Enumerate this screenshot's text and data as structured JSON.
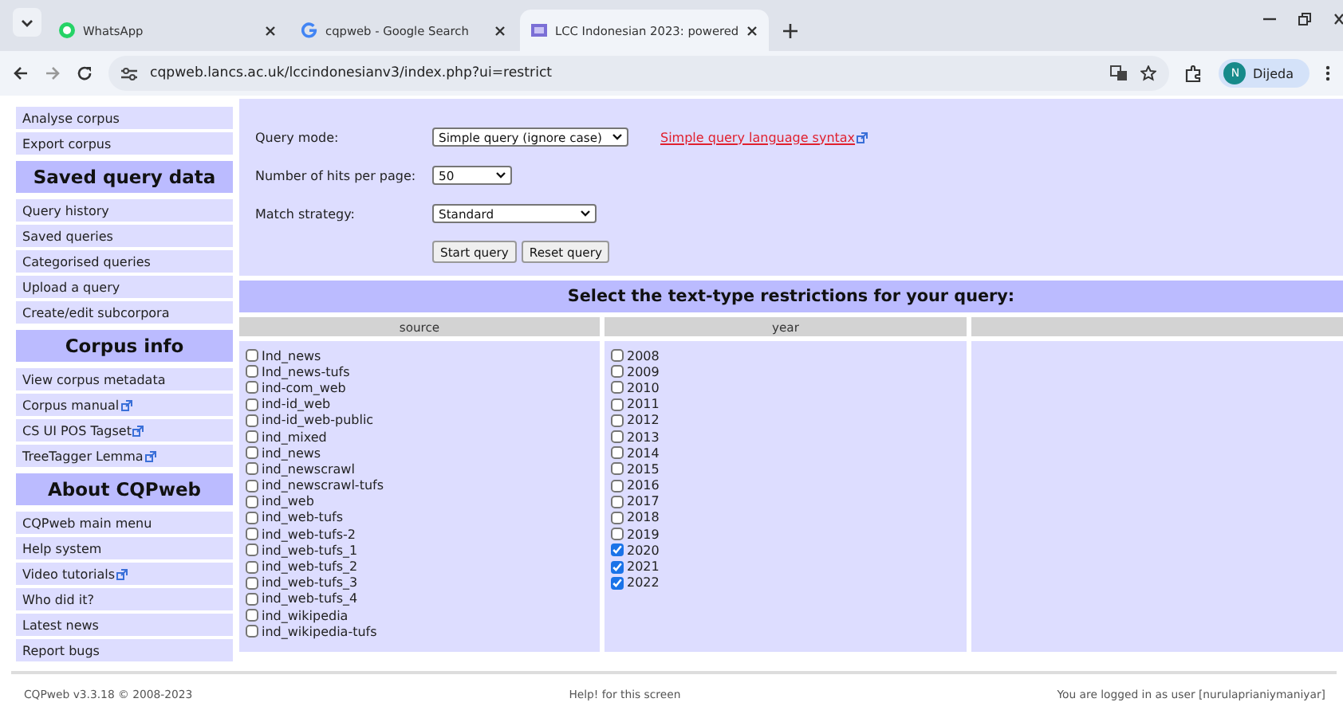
{
  "browser": {
    "tabs": [
      {
        "label": "WhatsApp",
        "selected": false
      },
      {
        "label": "cqpweb - Google Search",
        "selected": false
      },
      {
        "label": "LCC Indonesian 2023: powered",
        "selected": true
      }
    ],
    "url": "cqpweb.lancs.ac.uk/lccindonesianv3/index.php?ui=restrict",
    "profile": {
      "initial": "N",
      "name": "Dijeda"
    }
  },
  "sidebar": [
    {
      "kind": "item",
      "label": "Analyse corpus",
      "external": false
    },
    {
      "kind": "item",
      "label": "Export corpus",
      "external": false
    },
    {
      "kind": "heading",
      "label": "Saved query data"
    },
    {
      "kind": "item",
      "label": "Query history",
      "external": false
    },
    {
      "kind": "item",
      "label": "Saved queries",
      "external": false
    },
    {
      "kind": "item",
      "label": "Categorised queries",
      "external": false
    },
    {
      "kind": "item",
      "label": "Upload a query",
      "external": false
    },
    {
      "kind": "item",
      "label": "Create/edit subcorpora",
      "external": false
    },
    {
      "kind": "heading",
      "label": "Corpus info"
    },
    {
      "kind": "item",
      "label": "View corpus metadata",
      "external": false
    },
    {
      "kind": "item",
      "label": "Corpus manual",
      "external": true
    },
    {
      "kind": "item",
      "label": "CS UI POS Tagset",
      "external": true
    },
    {
      "kind": "item",
      "label": "TreeTagger Lemma",
      "external": true
    },
    {
      "kind": "heading",
      "label": "About CQPweb"
    },
    {
      "kind": "item",
      "label": "CQPweb main menu",
      "external": false
    },
    {
      "kind": "item",
      "label": "Help system",
      "external": false
    },
    {
      "kind": "item",
      "label": "Video tutorials",
      "external": true
    },
    {
      "kind": "item",
      "label": "Who did it?",
      "external": false
    },
    {
      "kind": "item",
      "label": "Latest news",
      "external": false
    },
    {
      "kind": "item",
      "label": "Report bugs",
      "external": false
    }
  ],
  "query_form": {
    "fields": [
      {
        "label": "Query mode:",
        "value": "Simple query (ignore case)"
      },
      {
        "label": "Number of hits per page:",
        "value": "50"
      },
      {
        "label": "Match strategy:",
        "value": "Standard"
      }
    ],
    "syntax_link": "Simple query language syntax",
    "buttons": [
      "Start query",
      "Reset query"
    ]
  },
  "restrictions": {
    "title": "Select the text-type restrictions for your query:",
    "columns": [
      {
        "heading": "source",
        "options": [
          {
            "label": "Ind_news",
            "checked": false
          },
          {
            "label": "Ind_news-tufs",
            "checked": false
          },
          {
            "label": "ind-com_web",
            "checked": false
          },
          {
            "label": "ind-id_web",
            "checked": false
          },
          {
            "label": "ind-id_web-public",
            "checked": false
          },
          {
            "label": "ind_mixed",
            "checked": false
          },
          {
            "label": "ind_news",
            "checked": false
          },
          {
            "label": "ind_newscrawl",
            "checked": false
          },
          {
            "label": "ind_newscrawl-tufs",
            "checked": false
          },
          {
            "label": "ind_web",
            "checked": false
          },
          {
            "label": "ind_web-tufs",
            "checked": false
          },
          {
            "label": "ind_web-tufs-2",
            "checked": false
          },
          {
            "label": "ind_web-tufs_1",
            "checked": false
          },
          {
            "label": "ind_web-tufs_2",
            "checked": false
          },
          {
            "label": "ind_web-tufs_3",
            "checked": false
          },
          {
            "label": "ind_web-tufs_4",
            "checked": false
          },
          {
            "label": "ind_wikipedia",
            "checked": false
          },
          {
            "label": "ind_wikipedia-tufs",
            "checked": false
          }
        ]
      },
      {
        "heading": "year",
        "options": [
          {
            "label": "2008",
            "checked": false
          },
          {
            "label": "2009",
            "checked": false
          },
          {
            "label": "2010",
            "checked": false
          },
          {
            "label": "2011",
            "checked": false
          },
          {
            "label": "2012",
            "checked": false
          },
          {
            "label": "2013",
            "checked": false
          },
          {
            "label": "2014",
            "checked": false
          },
          {
            "label": "2015",
            "checked": false
          },
          {
            "label": "2016",
            "checked": false
          },
          {
            "label": "2017",
            "checked": false
          },
          {
            "label": "2018",
            "checked": false
          },
          {
            "label": "2019",
            "checked": false
          },
          {
            "label": "2020",
            "checked": true
          },
          {
            "label": "2021",
            "checked": true
          },
          {
            "label": "2022",
            "checked": true
          }
        ]
      }
    ]
  },
  "footer": {
    "left": "CQPweb v3.3.18 © 2008-2023",
    "center": "Help! for this screen",
    "right": "You are logged in as user [nurulaprianiymaniyar]"
  }
}
